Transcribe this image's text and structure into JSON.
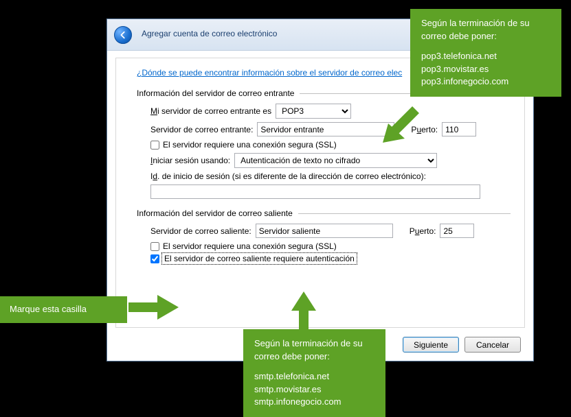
{
  "dialog": {
    "title": "Agregar cuenta de correo electrónico",
    "help_link": "¿Dónde se puede encontrar información sobre el servidor de correo elec"
  },
  "incoming": {
    "header": "Información del servidor de correo entrante",
    "type_label_pre": "M",
    "type_label_post": "i servidor de correo entrante es",
    "type_value": "POP3",
    "server_label": "Servidor de correo entrante:",
    "server_value": "Servidor entrante",
    "port_label_pre": "P",
    "port_label_u": "u",
    "port_label_post": "erto:",
    "port_value": "110",
    "ssl_label": "El servidor requiere una conexión segura (SSL)",
    "login_label_pre": "I",
    "login_label_post": "niciar sesión usando:",
    "auth_value": "Autenticación de texto no cifrado",
    "id_label_pre": "I",
    "id_label_u": "d",
    "id_label_post": ". de inicio de sesión (si es diferente de la dirección de correo electrónico):",
    "id_value": ""
  },
  "outgoing": {
    "header": "Información del servidor de correo saliente",
    "server_label": "Servidor de correo saliente:",
    "server_value": "Servidor saliente",
    "port_label_pre": "P",
    "port_label_u": "u",
    "port_label_post": "erto:",
    "port_value": "25",
    "ssl_label": "El servidor requiere una conexión segura (SSL)",
    "auth_label": "El servidor de correo saliente requiere autenticación"
  },
  "buttons": {
    "next": "Siguiente",
    "cancel": "Cancelar"
  },
  "callouts": {
    "top": {
      "hdr": "Según la terminación de su correo debe poner:",
      "l1": "pop3.telefonica.net",
      "l2": "pop3.movistar.es",
      "l3": "pop3.infonegocio.com"
    },
    "left": "Marque esta casilla",
    "bottom": {
      "hdr": "Según la terminación de su correo debe poner:",
      "l1": "smtp.telefonica.net",
      "l2": "smtp.movistar.es",
      "l3": "smtp.infonegocio.com"
    }
  }
}
